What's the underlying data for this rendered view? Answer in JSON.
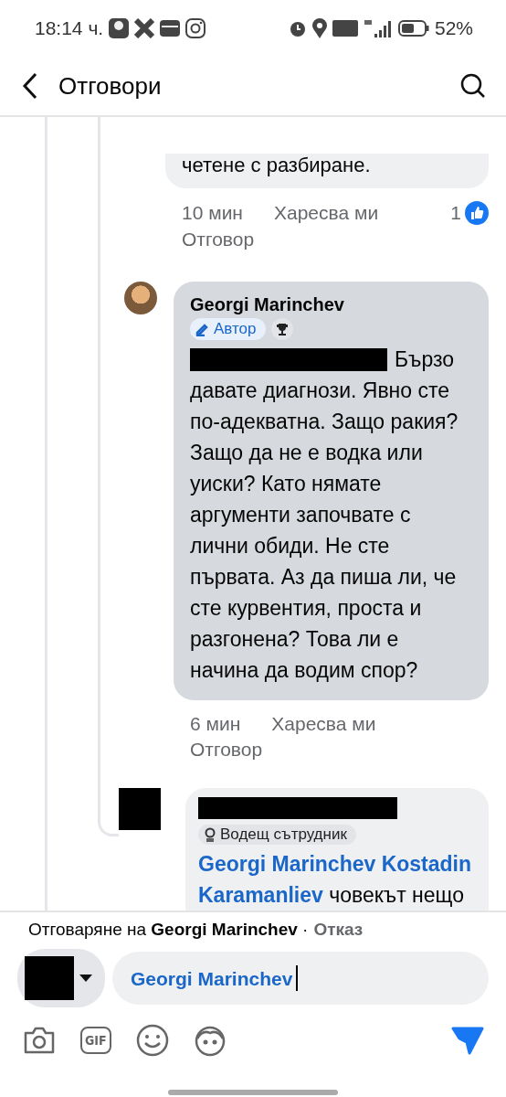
{
  "status_bar": {
    "time": "18:14 ч.",
    "battery": "52%"
  },
  "header": {
    "title": "Отговори"
  },
  "comments": [
    {
      "kind": "tail",
      "text": "четене с разбиране.",
      "time": "10 мин",
      "like": "Харесва ми",
      "reply": "Отговор",
      "reactions": "1"
    },
    {
      "kind": "author",
      "name": "Georgi Marinchev",
      "badge": "Автор",
      "lead": "Бързо",
      "text": "давате диагнози. Явно сте по-адекватна. Защо ракия? Защо да не е водка или уиски? Като нямате аргументи започвате с лични обиди. Не сте първата. Аз да пиша ли, че сте курвентия, проста и разгонена? Това ли е начина да водим спор?",
      "time": "6 мин",
      "like": "Харесва ми",
      "reply": "Отговор"
    },
    {
      "kind": "redacted",
      "badge": "Водещ сътрудник",
      "text": "**Georgi Marinchev Kostadin Karamanliev** човекът нещо"
    }
  ],
  "reply_bar": {
    "context": "Отговаряне на **Georgi Marinchev** ·",
    "cancel": "Отказ"
  },
  "composer": {
    "value": "Georgi Marinchev",
    "gif_label": "GIF"
  }
}
